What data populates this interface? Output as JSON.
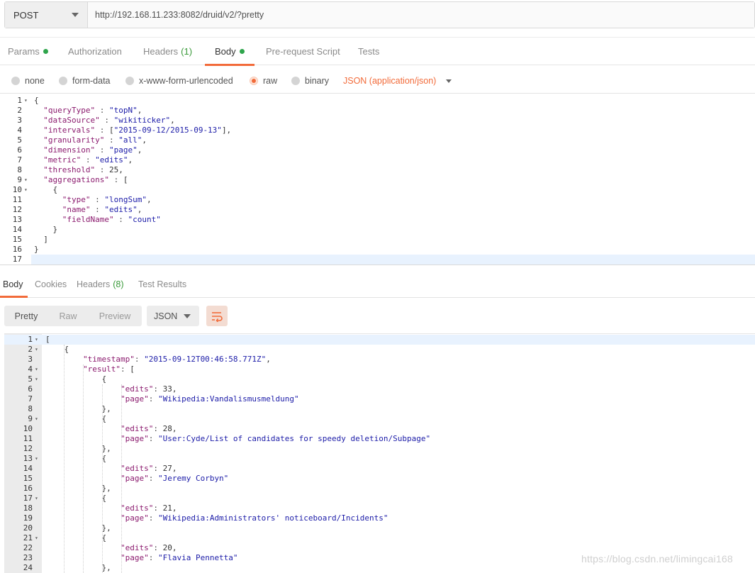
{
  "request": {
    "method": "POST",
    "url": "http://192.168.11.233:8082/druid/v2/?pretty",
    "tabs": [
      {
        "label": "Params",
        "dot": true
      },
      {
        "label": "Authorization"
      },
      {
        "label": "Headers",
        "count": "(1)"
      },
      {
        "label": "Body",
        "dot": true,
        "active": true
      },
      {
        "label": "Pre-request Script"
      },
      {
        "label": "Tests"
      }
    ],
    "body_modes": [
      "none",
      "form-data",
      "x-www-form-urlencoded",
      "raw",
      "binary"
    ],
    "selected_mode": "raw",
    "content_type": "JSON (application/json)",
    "body_lines": [
      "{",
      "  \"queryType\" : \"topN\",",
      "  \"dataSource\" : \"wikiticker\",",
      "  \"intervals\" : [\"2015-09-12/2015-09-13\"],",
      "  \"granularity\" : \"all\",",
      "  \"dimension\" : \"page\",",
      "  \"metric\" : \"edits\",",
      "  \"threshold\" : 25,",
      "  \"aggregations\" : [",
      "    {",
      "      \"type\" : \"longSum\",",
      "      \"name\" : \"edits\",",
      "      \"fieldName\" : \"count\"",
      "    }",
      "  ]",
      "}",
      ""
    ]
  },
  "response": {
    "tabs": [
      {
        "label": "Body",
        "active": true
      },
      {
        "label": "Cookies"
      },
      {
        "label": "Headers",
        "count": "(8)"
      },
      {
        "label": "Test Results"
      }
    ],
    "views": [
      "Pretty",
      "Raw",
      "Preview"
    ],
    "active_view": "Pretty",
    "format": "JSON",
    "body_lines": [
      "[",
      "    {",
      "        \"timestamp\": \"2015-09-12T00:46:58.771Z\",",
      "        \"result\": [",
      "            {",
      "                \"edits\": 33,",
      "                \"page\": \"Wikipedia:Vandalismusmeldung\"",
      "            },",
      "            {",
      "                \"edits\": 28,",
      "                \"page\": \"User:Cyde/List of candidates for speedy deletion/Subpage\"",
      "            },",
      "            {",
      "                \"edits\": 27,",
      "                \"page\": \"Jeremy Corbyn\"",
      "            },",
      "            {",
      "                \"edits\": 21,",
      "                \"page\": \"Wikipedia:Administrators' noticeboard/Incidents\"",
      "            },",
      "            {",
      "                \"edits\": 20,",
      "                \"page\": \"Flavia Pennetta\"",
      "            },"
    ]
  },
  "watermark": "https://blog.csdn.net/limingcai168",
  "colors": {
    "accent": "#f26b3a",
    "key": "#8b1a6e",
    "string": "#1c1ca8",
    "status_dot": "#2fa54c"
  }
}
